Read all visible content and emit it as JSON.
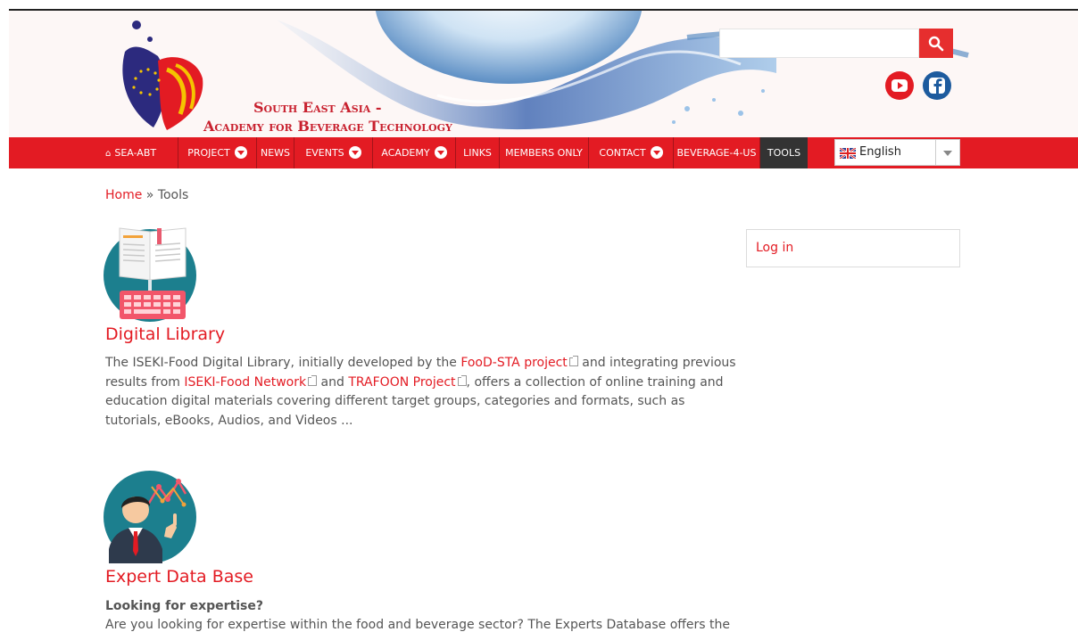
{
  "header": {
    "site_title_line1": "South East Asia -",
    "site_title_line2": "Academy for Beverage Technology",
    "search": {
      "placeholder": "",
      "button_icon": "search-icon"
    },
    "social": [
      {
        "name": "youtube",
        "icon": "youtube-icon",
        "color": "#e31b23"
      },
      {
        "name": "facebook",
        "icon": "facebook-icon",
        "color": "#1d5b9e"
      }
    ]
  },
  "nav": {
    "items": [
      {
        "label": "SEA-ABT",
        "icon": "home-icon"
      },
      {
        "label": "PROJECT",
        "dropdown": true
      },
      {
        "label": "NEWS"
      },
      {
        "label": "EVENTS",
        "dropdown": true
      },
      {
        "label": "ACADEMY",
        "dropdown": true
      },
      {
        "label": "LINKS"
      },
      {
        "label": "MEMBERS ONLY"
      },
      {
        "label": "CONTACT",
        "dropdown": true
      },
      {
        "label": "BEVERAGE-4-US"
      },
      {
        "label": "TOOLS",
        "active": true
      }
    ],
    "language": {
      "selected": "English",
      "flag": "uk-flag-icon"
    },
    "accent_color": "#e31b23",
    "active_color": "#333333"
  },
  "breadcrumb": {
    "home": "Home",
    "separator": " » ",
    "current": "Tools"
  },
  "tools": [
    {
      "title": "Digital Library",
      "image_icon": "digital-library-icon",
      "desc_parts": {
        "p1": "The ISEKI-Food Digital Library, initially developed by the ",
        "l1": "FooD-STA project",
        "p2": " and integrating previous results from ",
        "l2": "ISEKI-Food Network",
        "p3": " and ",
        "l3": "TRAFOON Project",
        "p4": ", offers a collection of online training and education digital materials covering different target groups, categories and formats, such as tutorials, eBooks, Audios, and Videos ..."
      }
    },
    {
      "title": "Expert Data Base",
      "image_icon": "expert-data-base-icon",
      "subtitle": "Looking for expertise?",
      "desc": "Are you looking for expertise within the food and beverage sector? The Experts Database offers the"
    }
  ],
  "sidebar": {
    "login_label": "Log in"
  }
}
